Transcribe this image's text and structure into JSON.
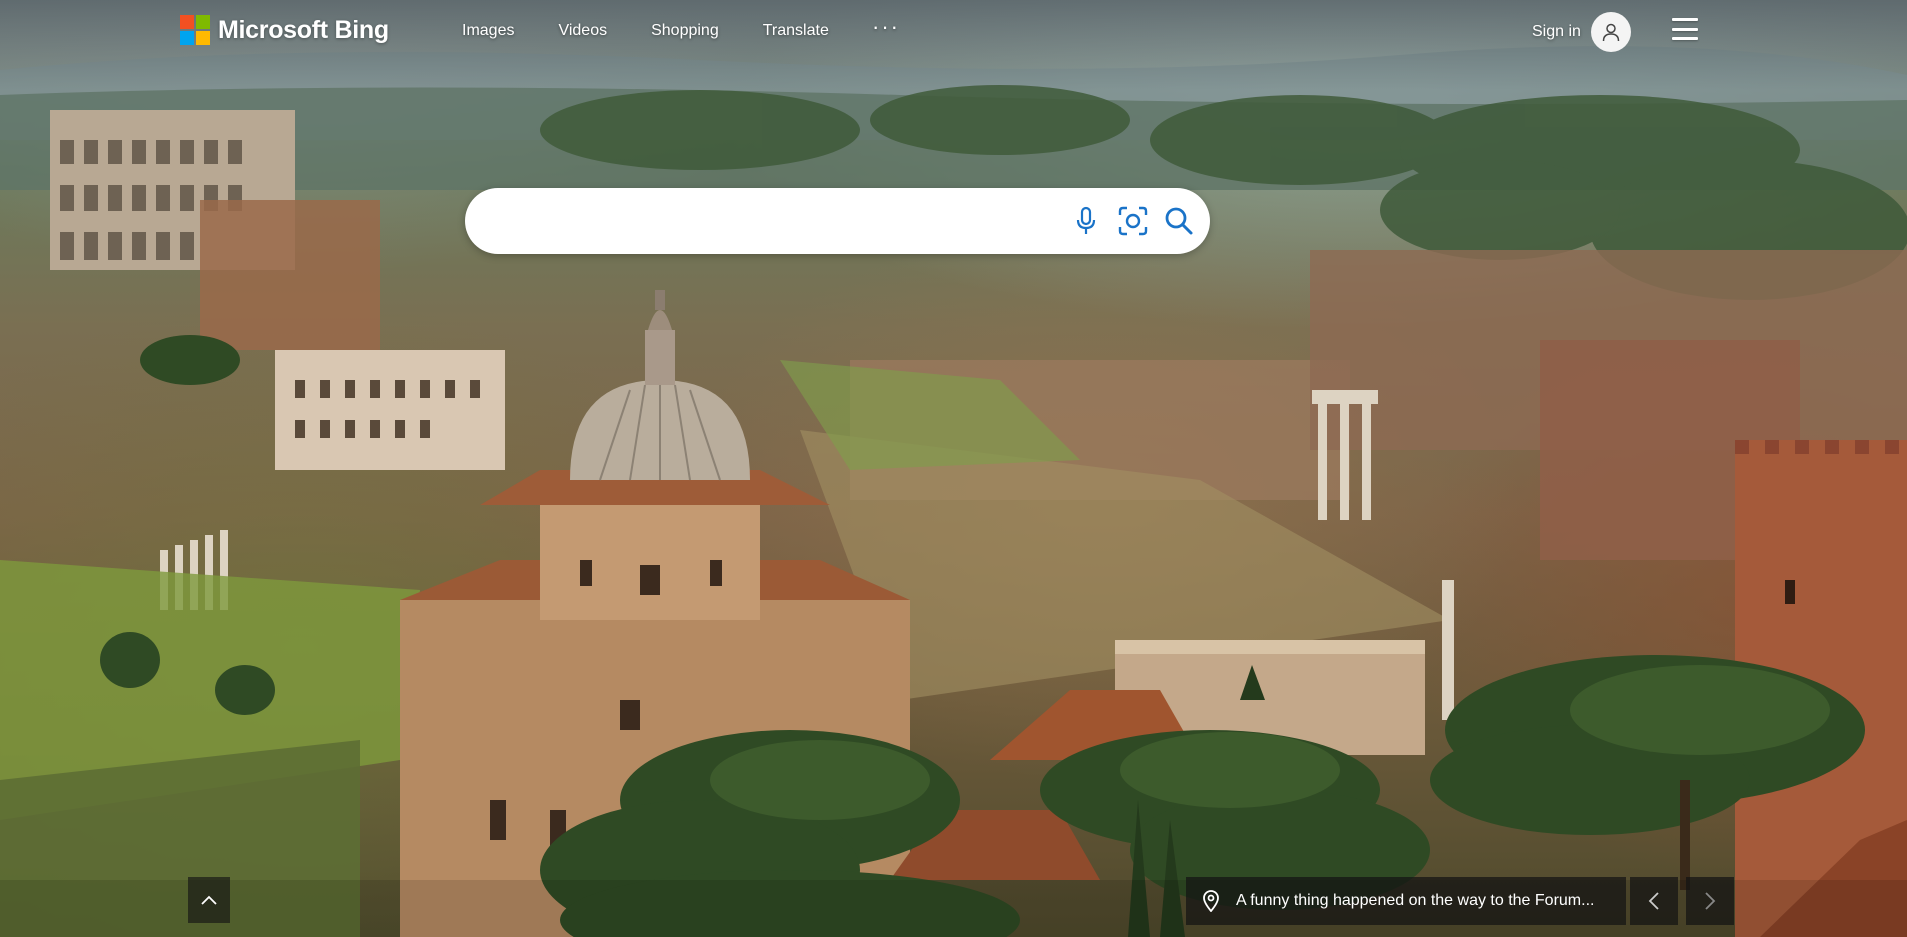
{
  "brand": {
    "name": "Microsoft Bing",
    "logo_colors": [
      "#f25022",
      "#7fba00",
      "#00a4ef",
      "#ffb900"
    ]
  },
  "nav": {
    "items": [
      {
        "label": "Images"
      },
      {
        "label": "Videos"
      },
      {
        "label": "Shopping"
      },
      {
        "label": "Translate"
      }
    ],
    "more_label": "···"
  },
  "account": {
    "signin_label": "Sign in",
    "avatar_icon": "person-icon"
  },
  "menu": {
    "icon": "hamburger-icon"
  },
  "search": {
    "value": "",
    "placeholder": "",
    "icons": [
      "microphone-icon",
      "visual-search-icon",
      "search-icon"
    ]
  },
  "image_info": {
    "caption": "A funny thing happened on the way to the Forum...",
    "location_icon": "map-pin-icon"
  },
  "controls": {
    "scroll_up_icon": "chevron-up-icon",
    "prev_icon": "chevron-left-icon",
    "next_icon": "chevron-right-icon"
  }
}
